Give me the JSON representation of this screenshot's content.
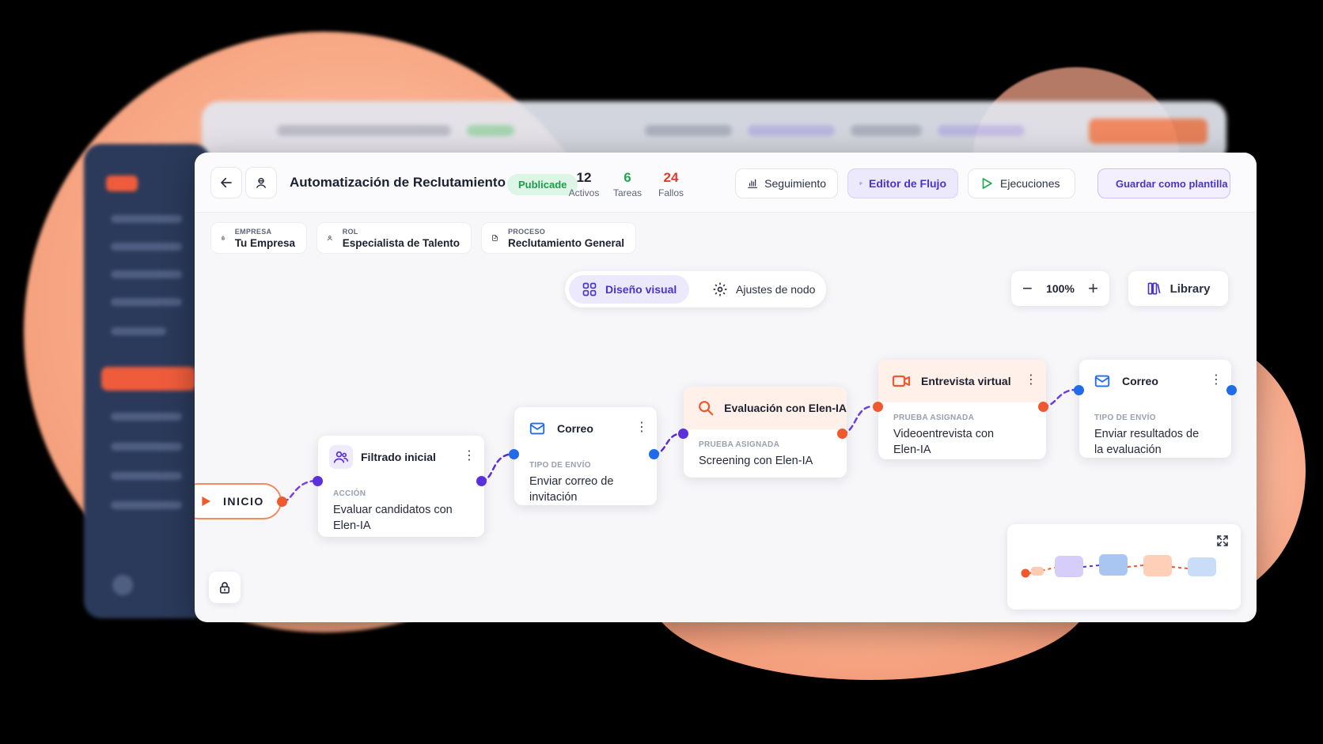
{
  "workflow": {
    "title": "Automatización de Reclutamiento",
    "status": "Publicade",
    "stats": [
      {
        "value": "12",
        "label": "Activos",
        "color": "#1c2030"
      },
      {
        "value": "6",
        "label": "Tareas",
        "color": "#1ea84f"
      },
      {
        "value": "24",
        "label": "Fallos",
        "color": "#e03a2a"
      }
    ]
  },
  "toolbar": {
    "tracking": "Seguimiento",
    "editor": "Editor de Flujo",
    "runs": "Ejecuciones",
    "save_template": "Guardar como plantilla"
  },
  "context": [
    {
      "label": "EMPRESA",
      "value": "Tu Empresa",
      "icon": "building-icon"
    },
    {
      "label": "ROL",
      "value": "Especialista de Talento",
      "icon": "user-icon"
    },
    {
      "label": "PROCESO",
      "value": "Reclutamiento General",
      "icon": "document-icon"
    }
  ],
  "view_toggle": {
    "visual": "Diseño visual",
    "settings": "Ajustes de nodo"
  },
  "zoom": {
    "level": "100%",
    "minus": "−",
    "plus": "+"
  },
  "library": {
    "label": "Library"
  },
  "canvas": {
    "start_label": "INICIO",
    "nodes": [
      {
        "title": "Filtrado inicial",
        "kind_label": "ACCIÓN",
        "value": "Evaluar candidatos con Elen-IA",
        "icon": "users-icon"
      },
      {
        "title": "Correo",
        "kind_label": "TIPO DE ENVÍO",
        "value": "Enviar correo de invitación",
        "icon": "mail-icon"
      },
      {
        "title": "Evaluación con Elen-IA",
        "kind_label": "PRUEBA ASIGNADA",
        "value": "Screening con Elen-IA",
        "icon": "search-icon"
      },
      {
        "title": "Entrevista virtual",
        "kind_label": "PRUEBA ASIGNADA",
        "value": "Videoentrevista con Elen-IA",
        "icon": "video-icon"
      },
      {
        "title": "Correo",
        "kind_label": "TIPO DE ENVÍO",
        "value": "Enviar resultados de la evaluación",
        "icon": "mail-icon"
      }
    ]
  },
  "colors": {
    "accent": "#4b35c8",
    "orange": "#f0582e",
    "blue": "#1f6be8",
    "purple": "#5b2fdc",
    "success": "#1ea84f",
    "danger": "#e03a2a"
  }
}
